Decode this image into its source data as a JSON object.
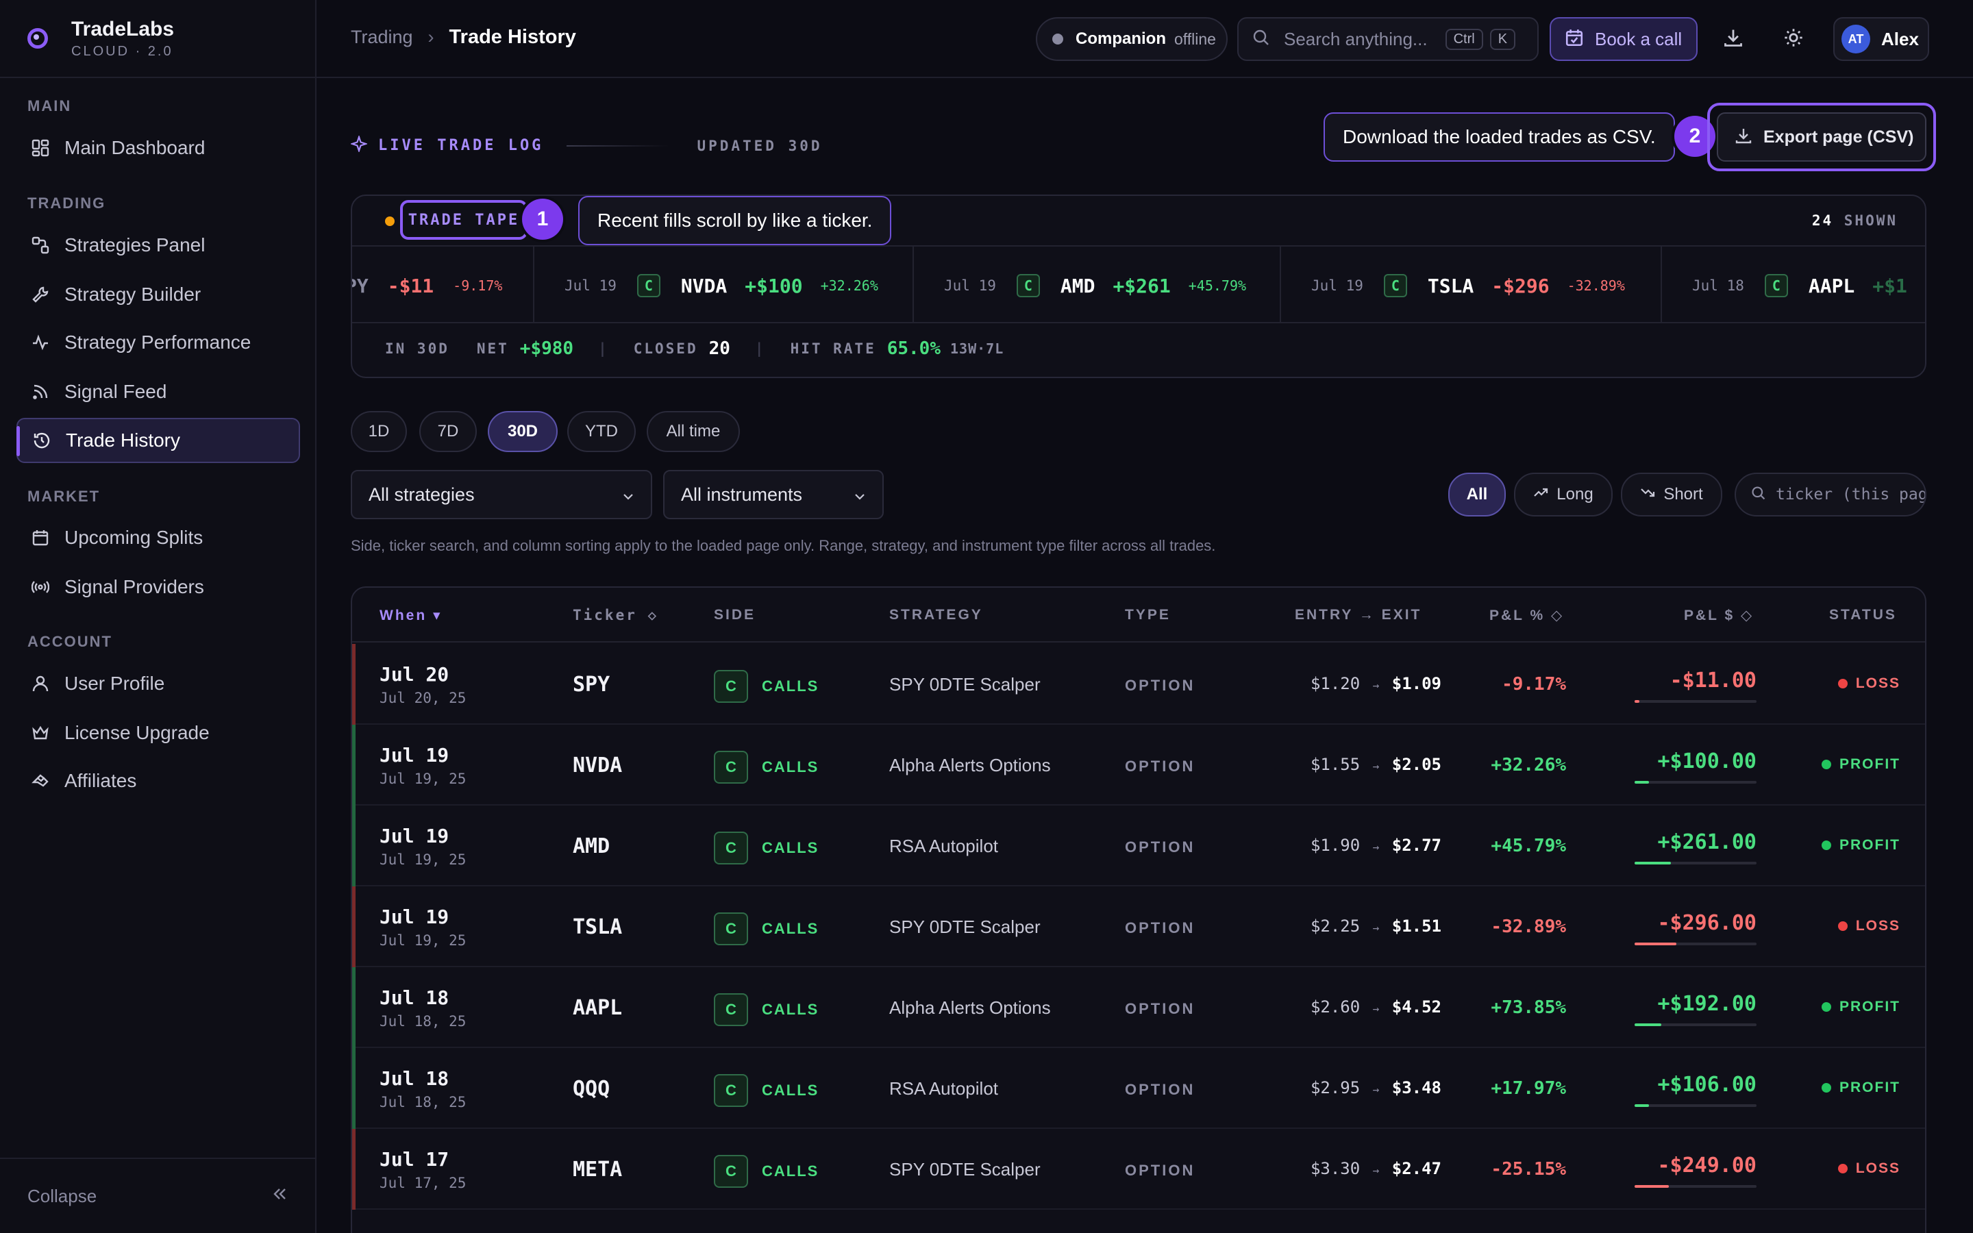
{
  "brand": {
    "name": "TradeLabs",
    "subtitle": "CLOUD · 2.0"
  },
  "sidebar": {
    "sections": [
      "MAIN",
      "TRADING",
      "MARKET",
      "ACCOUNT"
    ],
    "items": [
      {
        "label": "Main Dashboard",
        "icon": "dashboard-icon"
      },
      {
        "label": "Strategies Panel",
        "icon": "strategies-icon"
      },
      {
        "label": "Strategy Builder",
        "icon": "wrench-icon"
      },
      {
        "label": "Strategy Performance",
        "icon": "pulse-icon"
      },
      {
        "label": "Signal Feed",
        "icon": "rss-icon"
      },
      {
        "label": "Trade History",
        "icon": "history-icon"
      },
      {
        "label": "Upcoming Splits",
        "icon": "calendar-icon"
      },
      {
        "label": "Signal Providers",
        "icon": "broadcast-icon"
      },
      {
        "label": "User Profile",
        "icon": "user-icon"
      },
      {
        "label": "License Upgrade",
        "icon": "crown-icon"
      },
      {
        "label": "Affiliates",
        "icon": "affiliates-icon"
      }
    ],
    "collapse_label": "Collapse"
  },
  "header": {
    "breadcrumb_parent": "Trading",
    "breadcrumb_current": "Trade History",
    "companion_label": "Companion",
    "companion_status": "offline",
    "search_placeholder": "Search anything...",
    "kbd_1": "Ctrl",
    "kbd_2": "K",
    "book_call": "Book a call",
    "avatar_initials": "AT",
    "user_name": "Alex"
  },
  "log": {
    "title": "LIVE TRADE LOG",
    "updated": "UPDATED 30D",
    "export_label": "Export page (CSV)",
    "export_tooltip": "Download the loaded trades as CSV.",
    "export_step": "2"
  },
  "tape": {
    "label": "TRADE TAPE",
    "label_tail": "E",
    "step": "1",
    "tooltip": "Recent fills scroll by like a ticker.",
    "shown_count": "24",
    "shown_label": "SHOWN",
    "ticks": [
      {
        "date": "",
        "ticker": "PY",
        "usd": "-$11",
        "pct": "-9.17%",
        "pos": false
      },
      {
        "date": "Jul 19",
        "ticker": "NVDA",
        "usd": "+$100",
        "pct": "+32.26%",
        "pos": true
      },
      {
        "date": "Jul 19",
        "ticker": "AMD",
        "usd": "+$261",
        "pct": "+45.79%",
        "pos": true
      },
      {
        "date": "Jul 19",
        "ticker": "TSLA",
        "usd": "-$296",
        "pct": "-32.89%",
        "pos": false
      },
      {
        "date": "Jul 18",
        "ticker": "AAPL",
        "usd": "+$1",
        "pct": "",
        "pos": true
      }
    ],
    "badge": "C",
    "stats": {
      "period": "IN 30D",
      "net_label": "NET",
      "net_value": "+$980",
      "closed_label": "CLOSED",
      "closed_value": "20",
      "hit_label": "HIT RATE",
      "hit_value": "65.0%",
      "hit_detail": "13W·7L"
    }
  },
  "ranges": [
    "1D",
    "7D",
    "30D",
    "YTD",
    "All time"
  ],
  "filters": {
    "strategies": "All strategies",
    "instruments": "All instruments",
    "side_all": "All",
    "side_long": "Long",
    "side_short": "Short",
    "ticker_placeholder": "ticker (this page)",
    "note": "Side, ticker search, and column sorting apply to the loaded page only. Range, strategy, and instrument type filter across all trades."
  },
  "table": {
    "columns": [
      "When ▾",
      "Ticker ◇",
      "SIDE",
      "STRATEGY",
      "TYPE",
      "ENTRY → EXIT",
      "P&L % ◇",
      "P&L $ ◇",
      "STATUS"
    ],
    "rows": [
      {
        "when": "Jul 20",
        "when_sub": "Jul 20, 25",
        "ticker": "SPY",
        "side": "CALLS",
        "strategy": "SPY 0DTE Scalper",
        "type": "OPTION",
        "entry": "$1.20",
        "exit": "$1.09",
        "pct": "-9.17%",
        "usd": "-$11.00",
        "status": "LOSS",
        "pos": false,
        "fill": 0.04
      },
      {
        "when": "Jul 19",
        "when_sub": "Jul 19, 25",
        "ticker": "NVDA",
        "side": "CALLS",
        "strategy": "Alpha Alerts Options",
        "type": "OPTION",
        "entry": "$1.55",
        "exit": "$2.05",
        "pct": "+32.26%",
        "usd": "+$100.00",
        "status": "PROFIT",
        "pos": true,
        "fill": 0.12
      },
      {
        "when": "Jul 19",
        "when_sub": "Jul 19, 25",
        "ticker": "AMD",
        "side": "CALLS",
        "strategy": "RSA Autopilot",
        "type": "OPTION",
        "entry": "$1.90",
        "exit": "$2.77",
        "pct": "+45.79%",
        "usd": "+$261.00",
        "status": "PROFIT",
        "pos": true,
        "fill": 0.3
      },
      {
        "when": "Jul 19",
        "when_sub": "Jul 19, 25",
        "ticker": "TSLA",
        "side": "CALLS",
        "strategy": "SPY 0DTE Scalper",
        "type": "OPTION",
        "entry": "$2.25",
        "exit": "$1.51",
        "pct": "-32.89%",
        "usd": "-$296.00",
        "status": "LOSS",
        "pos": false,
        "fill": 0.34
      },
      {
        "when": "Jul 18",
        "when_sub": "Jul 18, 25",
        "ticker": "AAPL",
        "side": "CALLS",
        "strategy": "Alpha Alerts Options",
        "type": "OPTION",
        "entry": "$2.60",
        "exit": "$4.52",
        "pct": "+73.85%",
        "usd": "+$192.00",
        "status": "PROFIT",
        "pos": true,
        "fill": 0.22
      },
      {
        "when": "Jul 18",
        "when_sub": "Jul 18, 25",
        "ticker": "QQQ",
        "side": "CALLS",
        "strategy": "RSA Autopilot",
        "type": "OPTION",
        "entry": "$2.95",
        "exit": "$3.48",
        "pct": "+17.97%",
        "usd": "+$106.00",
        "status": "PROFIT",
        "pos": true,
        "fill": 0.12
      },
      {
        "when": "Jul 17",
        "when_sub": "Jul 17, 25",
        "ticker": "META",
        "side": "CALLS",
        "strategy": "SPY 0DTE Scalper",
        "type": "OPTION",
        "entry": "$3.30",
        "exit": "$2.47",
        "pct": "-25.15%",
        "usd": "-$249.00",
        "status": "LOSS",
        "pos": false,
        "fill": 0.28
      }
    ]
  },
  "colors": {
    "accent": "#8b5cf6",
    "profit": "#4ade80",
    "loss": "#f87171",
    "bg": "#0c0c14"
  }
}
